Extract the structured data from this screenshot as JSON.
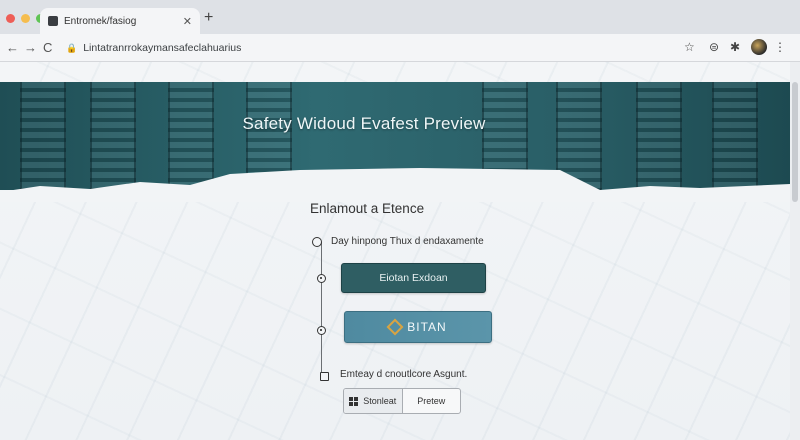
{
  "browser": {
    "tab_title": "Entromek/fasiog",
    "tab_close": "✕",
    "new_tab": "+",
    "nav_back": "←",
    "nav_forward": "→",
    "nav_reload": "C",
    "lock": "🔒",
    "url": "Lintatranrrokaymansafeclahuarius",
    "traffic_colors": [
      "#ee5e57",
      "#f5bd4f",
      "#5fc454"
    ],
    "toolbar_icons": [
      "star-icon",
      "lock-icon",
      "puzzle-icon",
      "avatar",
      "menu-icon"
    ]
  },
  "banner": {
    "title": "Safety Widoud Evafest Preview"
  },
  "section": {
    "title": "Enlamout a Etence"
  },
  "steps": {
    "step1_label": "Day hinpong Thux d endaxamente",
    "primary_button": "Eiotan Exdoan",
    "brand_button": "BITAN",
    "step4_label": "Emteay d cnoutlcore Asgunt."
  },
  "segment": {
    "option1": "Stonleat",
    "option2": "Pretew"
  },
  "colors": {
    "banner": "#2f6a72",
    "primary_button": "#2f5e63",
    "brand_button": "#5b95aa",
    "brand_accent": "#d9a441"
  }
}
